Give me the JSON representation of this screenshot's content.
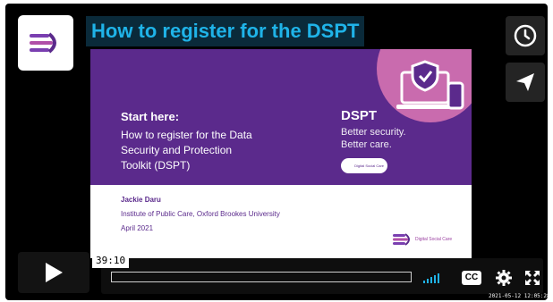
{
  "video": {
    "title": "How to register for the DSPT",
    "timecode": "39:10",
    "recording_timestamp": "2021-05-12 12:05:28",
    "progress": 0,
    "accent_color": "#1fb3e8",
    "title_bg_color": "#0a2a3a"
  },
  "side_buttons": [
    {
      "icon": "clock-icon"
    },
    {
      "icon": "paper-plane-icon"
    }
  ],
  "slide": {
    "heading": "Start here:",
    "subtitle_lines": [
      "How to register for the Data",
      "Security and Protection",
      "Toolkit (DSPT)"
    ],
    "dspt_title": "DSPT",
    "tagline_lines": [
      "Better security.",
      "Better care."
    ],
    "presenter": "Jackie Daru",
    "organization": "Institute of Public Care, Oxford Brookes University",
    "date": "April 2021",
    "logo_text": "Digital Social Care",
    "brand_purple": "#5b2a8c",
    "brand_pink": "#d06fb0"
  },
  "controls": {
    "play_icon": "play-icon",
    "cc_label": "CC",
    "volume_icon": "volume-bars-icon",
    "settings_icon": "gear-icon",
    "fullscreen_icon": "fullscreen-icon"
  }
}
